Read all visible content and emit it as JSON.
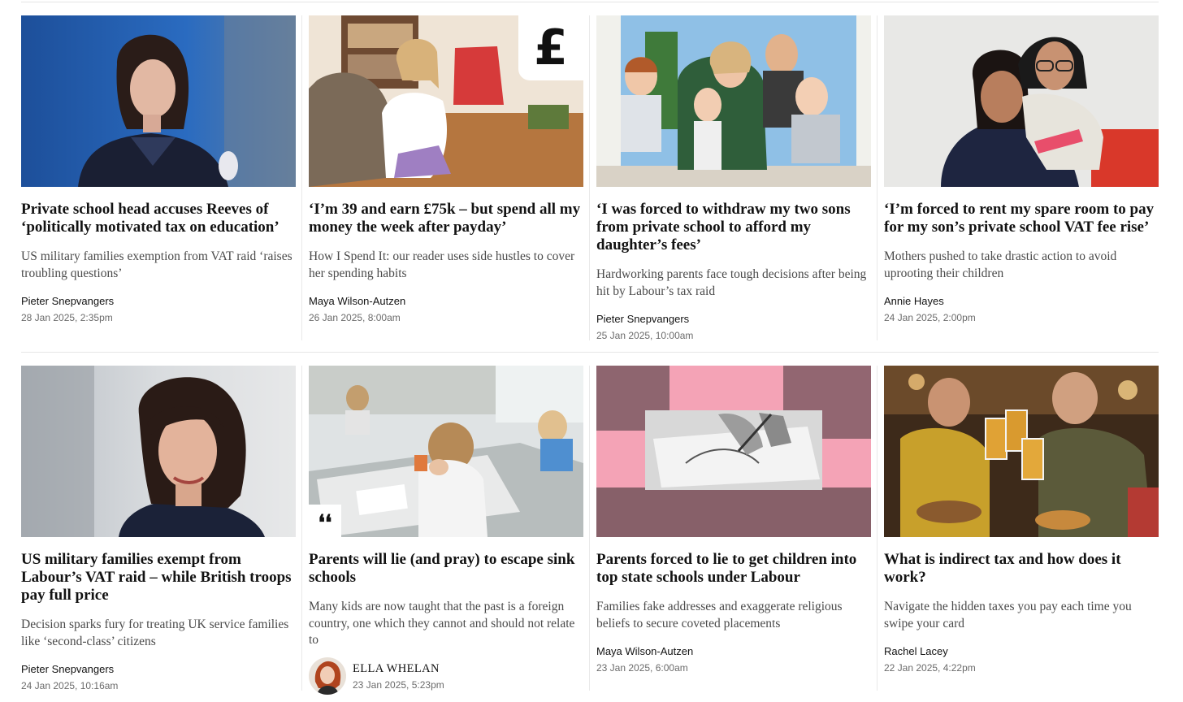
{
  "articles": [
    {
      "image_icon": "reeves-photo",
      "headline": "Private school head accuses Reeves of ‘politically motivated tax on education’",
      "standfirst": "US military families exemption from VAT raid ‘raises troubling questions’",
      "author": "Pieter Snepvangers",
      "date": "28 Jan 2025, 2:35pm"
    },
    {
      "image_icon": "woman-phone-photo",
      "badge": "£",
      "headline": "‘I’m 39 and earn £75k – but spend all my money the week after payday’",
      "standfirst": "How I Spend It: our reader uses side hustles to cover her spending habits",
      "author": "Maya Wilson-Autzen",
      "date": "26 Jan 2025, 8:00am"
    },
    {
      "image_icon": "family-photo",
      "headline": "‘I was forced to withdraw my two sons from private school to afford my daughter’s fees’",
      "standfirst": "Hardworking parents face tough decisions after being hit by Labour’s tax raid",
      "author": "Pieter Snepvangers",
      "date": "25 Jan 2025, 10:00am"
    },
    {
      "image_icon": "mother-son-photo",
      "headline": "‘I’m forced to rent my spare room to pay for my son’s private school VAT fee rise’",
      "standfirst": "Mothers pushed to take drastic action to avoid uprooting their children",
      "author": "Annie Hayes",
      "date": "24 Jan 2025, 2:00pm"
    },
    {
      "image_icon": "reeves-portrait-photo",
      "headline": "US military families exempt from Labour’s VAT raid – while British troops pay full price",
      "standfirst": "Decision sparks fury for treating UK service families like ‘second-class’ citizens",
      "author": "Pieter Snepvangers",
      "date": "24 Jan 2025, 10:16am"
    },
    {
      "image_icon": "classroom-photo",
      "badge": "❛❛",
      "headline": "Parents will lie (and pray) to escape sink schools",
      "standfirst": "Many kids are now taught that the past is a foreign country, one which they cannot and should not relate to",
      "author": "ELLA WHELAN",
      "date": "23 Jan 2025, 5:23pm"
    },
    {
      "image_icon": "signing-collage-photo",
      "headline": "Parents forced to lie to get children into top state schools under Labour",
      "standfirst": "Families fake addresses and exaggerate religious beliefs to secure coveted placements",
      "author": "Maya Wilson-Autzen",
      "date": "23 Jan 2025, 6:00am"
    },
    {
      "image_icon": "pub-cheers-photo",
      "headline": "What is indirect tax and how does it work?",
      "standfirst": "Navigate the hidden taxes you pay each time you swipe your card",
      "author": "Rachel Lacey",
      "date": "22 Jan 2025, 4:22pm"
    }
  ]
}
